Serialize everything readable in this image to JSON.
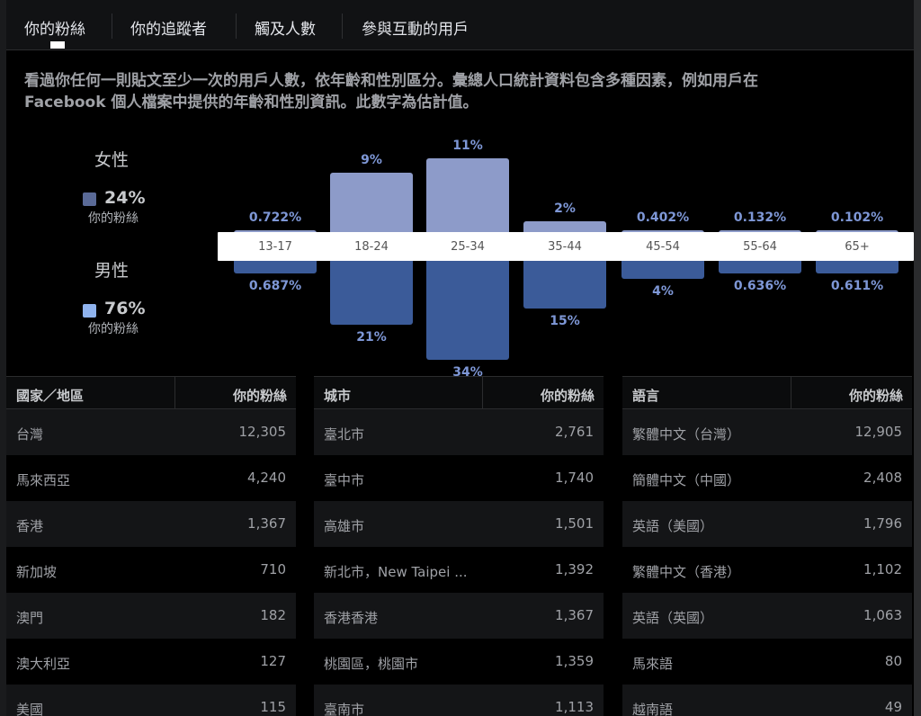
{
  "tabs": [
    {
      "label": "你的粉絲",
      "active": true
    },
    {
      "label": "你的追蹤者",
      "active": false
    },
    {
      "label": "觸及人數",
      "active": false
    },
    {
      "label": "參與互動的用戶",
      "active": false
    }
  ],
  "description": {
    "line1": "看過你任何一則貼文至少一次的用戶人數，依年齡和性別區分。彙總人口統計資料包含多種因素，例如用戶在",
    "line2": "Facebook 個人檔案中提供的年齡和性別資訊。此數字為估計值。"
  },
  "legend": {
    "female": {
      "title": "女性",
      "percent": "24%",
      "sub": "你的粉絲",
      "color": "#5a6a97"
    },
    "male": {
      "title": "男性",
      "percent": "76%",
      "sub": "你的粉絲",
      "color": "#8fb3ee"
    }
  },
  "chart_data": {
    "type": "bar",
    "categories": [
      "13-17",
      "18-24",
      "25-34",
      "35-44",
      "45-54",
      "55-64",
      "65+"
    ],
    "series": [
      {
        "name": "女性",
        "values": [
          0.722,
          9,
          11,
          2,
          0.402,
          0.132,
          0.102
        ],
        "labels": [
          "0.722%",
          "9%",
          "11%",
          "2%",
          "0.402%",
          "0.132%",
          "0.102%"
        ],
        "color": "#8d9bc9"
      },
      {
        "name": "男性",
        "values": [
          0.687,
          21,
          34,
          15,
          4,
          0.636,
          0.611
        ],
        "labels": [
          "0.687%",
          "21%",
          "34%",
          "15%",
          "4%",
          "0.636%",
          "0.611%"
        ],
        "color": "#3b5b99"
      }
    ]
  },
  "tables": [
    {
      "header_left": "國家／地區",
      "header_right": "你的粉絲",
      "rows": [
        {
          "name": "台灣",
          "value": "12,305"
        },
        {
          "name": "馬來西亞",
          "value": "4,240"
        },
        {
          "name": "香港",
          "value": "1,367"
        },
        {
          "name": "新加坡",
          "value": "710"
        },
        {
          "name": "澳門",
          "value": "182"
        },
        {
          "name": "澳大利亞",
          "value": "127"
        },
        {
          "name": "美國",
          "value": "115"
        }
      ]
    },
    {
      "header_left": "城市",
      "header_right": "你的粉絲",
      "rows": [
        {
          "name": "臺北市",
          "value": "2,761"
        },
        {
          "name": "臺中市",
          "value": "1,740"
        },
        {
          "name": "高雄市",
          "value": "1,501"
        },
        {
          "name": "新北市，New Taipei ...",
          "value": "1,392"
        },
        {
          "name": "香港香港",
          "value": "1,367"
        },
        {
          "name": "桃園區，桃園市",
          "value": "1,359"
        },
        {
          "name": "臺南市",
          "value": "1,113"
        }
      ]
    },
    {
      "header_left": "語言",
      "header_right": "你的粉絲",
      "rows": [
        {
          "name": "繁體中文（台灣）",
          "value": "12,905"
        },
        {
          "name": "簡體中文（中國）",
          "value": "2,408"
        },
        {
          "name": "英語（美國）",
          "value": "1,796"
        },
        {
          "name": "繁體中文（香港）",
          "value": "1,102"
        },
        {
          "name": "英語（英國）",
          "value": "1,063"
        },
        {
          "name": "馬來語",
          "value": "80"
        },
        {
          "name": "越南語",
          "value": "49"
        }
      ]
    }
  ]
}
